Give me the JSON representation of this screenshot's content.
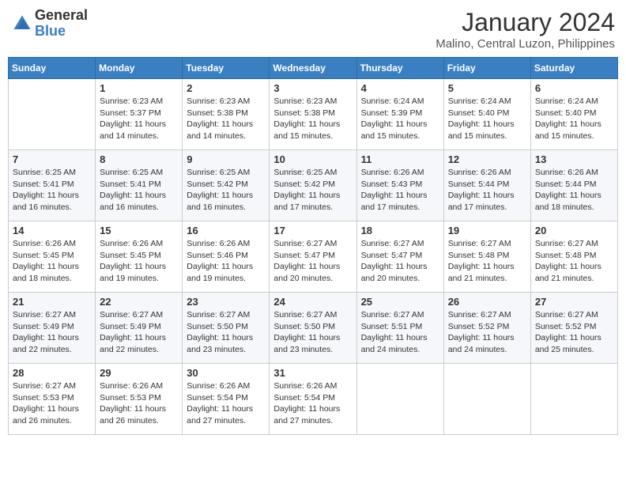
{
  "logo": {
    "general": "General",
    "blue": "Blue"
  },
  "header": {
    "month": "January 2024",
    "location": "Malino, Central Luzon, Philippines"
  },
  "weekdays": [
    "Sunday",
    "Monday",
    "Tuesday",
    "Wednesday",
    "Thursday",
    "Friday",
    "Saturday"
  ],
  "weeks": [
    [
      {
        "day": "",
        "sunrise": "",
        "sunset": "",
        "daylight": ""
      },
      {
        "day": "1",
        "sunrise": "Sunrise: 6:23 AM",
        "sunset": "Sunset: 5:37 PM",
        "daylight": "Daylight: 11 hours and 14 minutes."
      },
      {
        "day": "2",
        "sunrise": "Sunrise: 6:23 AM",
        "sunset": "Sunset: 5:38 PM",
        "daylight": "Daylight: 11 hours and 14 minutes."
      },
      {
        "day": "3",
        "sunrise": "Sunrise: 6:23 AM",
        "sunset": "Sunset: 5:38 PM",
        "daylight": "Daylight: 11 hours and 15 minutes."
      },
      {
        "day": "4",
        "sunrise": "Sunrise: 6:24 AM",
        "sunset": "Sunset: 5:39 PM",
        "daylight": "Daylight: 11 hours and 15 minutes."
      },
      {
        "day": "5",
        "sunrise": "Sunrise: 6:24 AM",
        "sunset": "Sunset: 5:40 PM",
        "daylight": "Daylight: 11 hours and 15 minutes."
      },
      {
        "day": "6",
        "sunrise": "Sunrise: 6:24 AM",
        "sunset": "Sunset: 5:40 PM",
        "daylight": "Daylight: 11 hours and 15 minutes."
      }
    ],
    [
      {
        "day": "7",
        "sunrise": "Sunrise: 6:25 AM",
        "sunset": "Sunset: 5:41 PM",
        "daylight": "Daylight: 11 hours and 16 minutes."
      },
      {
        "day": "8",
        "sunrise": "Sunrise: 6:25 AM",
        "sunset": "Sunset: 5:41 PM",
        "daylight": "Daylight: 11 hours and 16 minutes."
      },
      {
        "day": "9",
        "sunrise": "Sunrise: 6:25 AM",
        "sunset": "Sunset: 5:42 PM",
        "daylight": "Daylight: 11 hours and 16 minutes."
      },
      {
        "day": "10",
        "sunrise": "Sunrise: 6:25 AM",
        "sunset": "Sunset: 5:42 PM",
        "daylight": "Daylight: 11 hours and 17 minutes."
      },
      {
        "day": "11",
        "sunrise": "Sunrise: 6:26 AM",
        "sunset": "Sunset: 5:43 PM",
        "daylight": "Daylight: 11 hours and 17 minutes."
      },
      {
        "day": "12",
        "sunrise": "Sunrise: 6:26 AM",
        "sunset": "Sunset: 5:44 PM",
        "daylight": "Daylight: 11 hours and 17 minutes."
      },
      {
        "day": "13",
        "sunrise": "Sunrise: 6:26 AM",
        "sunset": "Sunset: 5:44 PM",
        "daylight": "Daylight: 11 hours and 18 minutes."
      }
    ],
    [
      {
        "day": "14",
        "sunrise": "Sunrise: 6:26 AM",
        "sunset": "Sunset: 5:45 PM",
        "daylight": "Daylight: 11 hours and 18 minutes."
      },
      {
        "day": "15",
        "sunrise": "Sunrise: 6:26 AM",
        "sunset": "Sunset: 5:45 PM",
        "daylight": "Daylight: 11 hours and 19 minutes."
      },
      {
        "day": "16",
        "sunrise": "Sunrise: 6:26 AM",
        "sunset": "Sunset: 5:46 PM",
        "daylight": "Daylight: 11 hours and 19 minutes."
      },
      {
        "day": "17",
        "sunrise": "Sunrise: 6:27 AM",
        "sunset": "Sunset: 5:47 PM",
        "daylight": "Daylight: 11 hours and 20 minutes."
      },
      {
        "day": "18",
        "sunrise": "Sunrise: 6:27 AM",
        "sunset": "Sunset: 5:47 PM",
        "daylight": "Daylight: 11 hours and 20 minutes."
      },
      {
        "day": "19",
        "sunrise": "Sunrise: 6:27 AM",
        "sunset": "Sunset: 5:48 PM",
        "daylight": "Daylight: 11 hours and 21 minutes."
      },
      {
        "day": "20",
        "sunrise": "Sunrise: 6:27 AM",
        "sunset": "Sunset: 5:48 PM",
        "daylight": "Daylight: 11 hours and 21 minutes."
      }
    ],
    [
      {
        "day": "21",
        "sunrise": "Sunrise: 6:27 AM",
        "sunset": "Sunset: 5:49 PM",
        "daylight": "Daylight: 11 hours and 22 minutes."
      },
      {
        "day": "22",
        "sunrise": "Sunrise: 6:27 AM",
        "sunset": "Sunset: 5:49 PM",
        "daylight": "Daylight: 11 hours and 22 minutes."
      },
      {
        "day": "23",
        "sunrise": "Sunrise: 6:27 AM",
        "sunset": "Sunset: 5:50 PM",
        "daylight": "Daylight: 11 hours and 23 minutes."
      },
      {
        "day": "24",
        "sunrise": "Sunrise: 6:27 AM",
        "sunset": "Sunset: 5:50 PM",
        "daylight": "Daylight: 11 hours and 23 minutes."
      },
      {
        "day": "25",
        "sunrise": "Sunrise: 6:27 AM",
        "sunset": "Sunset: 5:51 PM",
        "daylight": "Daylight: 11 hours and 24 minutes."
      },
      {
        "day": "26",
        "sunrise": "Sunrise: 6:27 AM",
        "sunset": "Sunset: 5:52 PM",
        "daylight": "Daylight: 11 hours and 24 minutes."
      },
      {
        "day": "27",
        "sunrise": "Sunrise: 6:27 AM",
        "sunset": "Sunset: 5:52 PM",
        "daylight": "Daylight: 11 hours and 25 minutes."
      }
    ],
    [
      {
        "day": "28",
        "sunrise": "Sunrise: 6:27 AM",
        "sunset": "Sunset: 5:53 PM",
        "daylight": "Daylight: 11 hours and 26 minutes."
      },
      {
        "day": "29",
        "sunrise": "Sunrise: 6:26 AM",
        "sunset": "Sunset: 5:53 PM",
        "daylight": "Daylight: 11 hours and 26 minutes."
      },
      {
        "day": "30",
        "sunrise": "Sunrise: 6:26 AM",
        "sunset": "Sunset: 5:54 PM",
        "daylight": "Daylight: 11 hours and 27 minutes."
      },
      {
        "day": "31",
        "sunrise": "Sunrise: 6:26 AM",
        "sunset": "Sunset: 5:54 PM",
        "daylight": "Daylight: 11 hours and 27 minutes."
      },
      {
        "day": "",
        "sunrise": "",
        "sunset": "",
        "daylight": ""
      },
      {
        "day": "",
        "sunrise": "",
        "sunset": "",
        "daylight": ""
      },
      {
        "day": "",
        "sunrise": "",
        "sunset": "",
        "daylight": ""
      }
    ]
  ]
}
